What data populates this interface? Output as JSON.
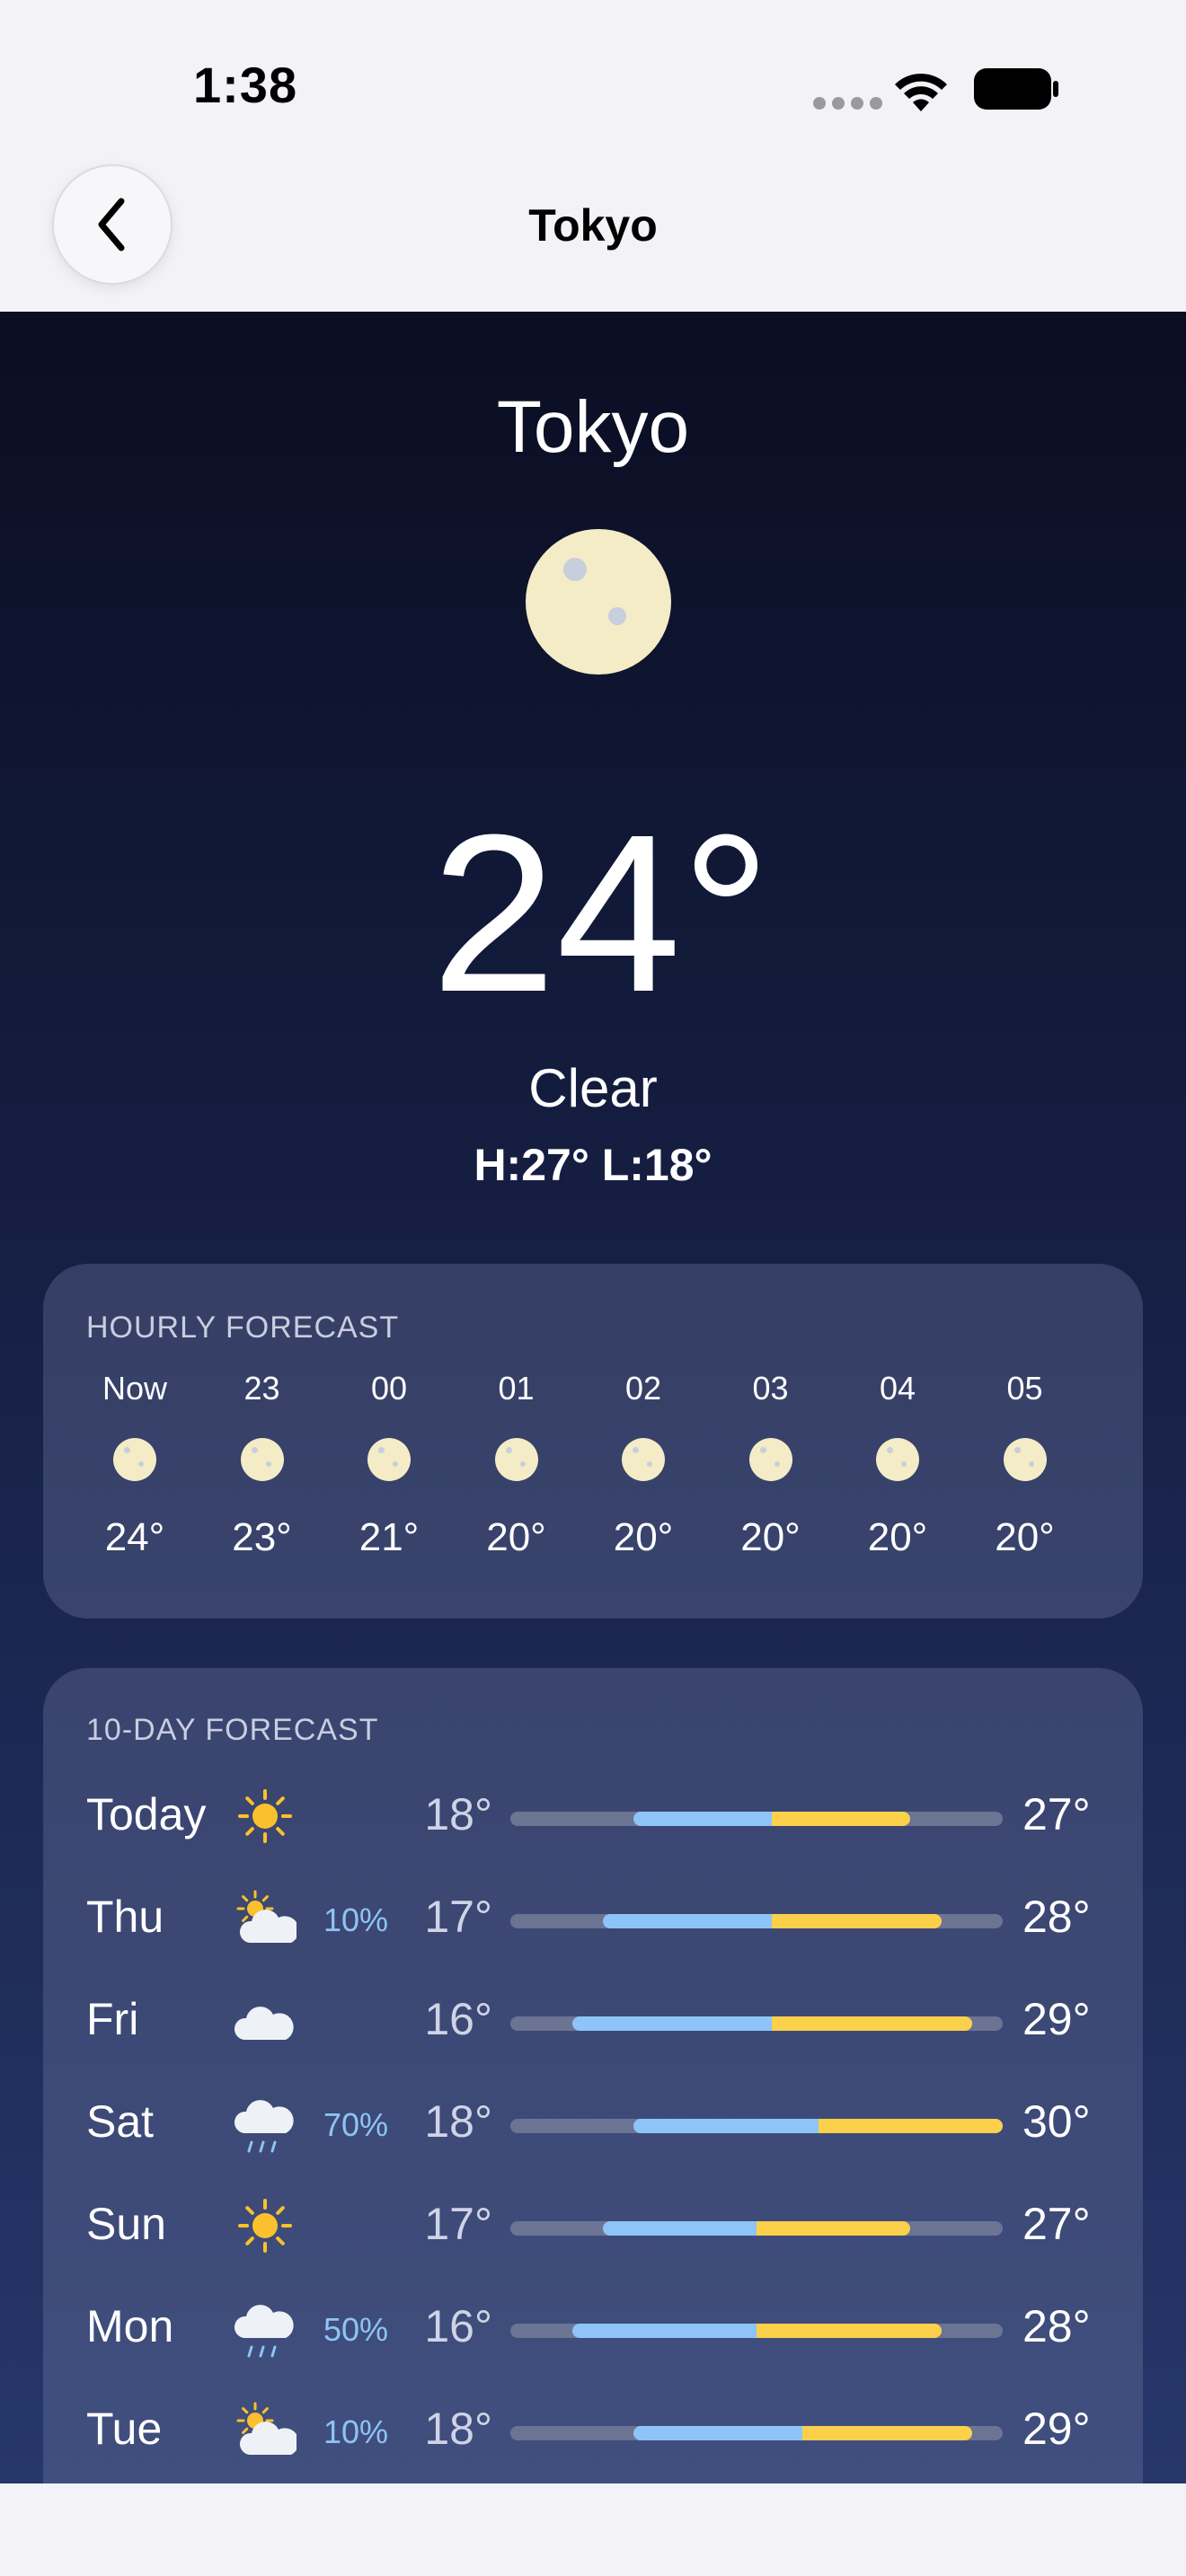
{
  "status": {
    "time": "1:38"
  },
  "nav": {
    "title": "Tokyo"
  },
  "current": {
    "city": "Tokyo",
    "icon": "moon-icon",
    "temperature": "24°",
    "condition": "Clear",
    "high_low": "H:27° L:18°"
  },
  "hourly": {
    "title": "HOURLY FORECAST",
    "items": [
      {
        "label": "Now",
        "icon": "moon-icon",
        "temp": "24°"
      },
      {
        "label": "23",
        "icon": "moon-icon",
        "temp": "23°"
      },
      {
        "label": "00",
        "icon": "moon-icon",
        "temp": "21°"
      },
      {
        "label": "01",
        "icon": "moon-icon",
        "temp": "20°"
      },
      {
        "label": "02",
        "icon": "moon-icon",
        "temp": "20°"
      },
      {
        "label": "03",
        "icon": "moon-icon",
        "temp": "20°"
      },
      {
        "label": "04",
        "icon": "moon-icon",
        "temp": "20°"
      },
      {
        "label": "05",
        "icon": "moon-icon",
        "temp": "20°"
      }
    ]
  },
  "daily": {
    "title": "10-DAY FORECAST",
    "range": {
      "min": 14,
      "max": 30
    },
    "items": [
      {
        "day": "Today",
        "icon": "sun-icon",
        "precip": "",
        "low": "18°",
        "high": "27°",
        "low_val": 18,
        "high_val": 27
      },
      {
        "day": "Thu",
        "icon": "partly-cloudy-icon",
        "precip": "10%",
        "low": "17°",
        "high": "28°",
        "low_val": 17,
        "high_val": 28
      },
      {
        "day": "Fri",
        "icon": "cloud-icon",
        "precip": "",
        "low": "16°",
        "high": "29°",
        "low_val": 16,
        "high_val": 29
      },
      {
        "day": "Sat",
        "icon": "rain-icon",
        "precip": "70%",
        "low": "18°",
        "high": "30°",
        "low_val": 18,
        "high_val": 30
      },
      {
        "day": "Sun",
        "icon": "sun-icon",
        "precip": "",
        "low": "17°",
        "high": "27°",
        "low_val": 17,
        "high_val": 27
      },
      {
        "day": "Mon",
        "icon": "rain-icon",
        "precip": "50%",
        "low": "16°",
        "high": "28°",
        "low_val": 16,
        "high_val": 28
      },
      {
        "day": "Tue",
        "icon": "partly-cloudy-icon",
        "precip": "10%",
        "low": "18°",
        "high": "29°",
        "low_val": 18,
        "high_val": 29
      }
    ]
  },
  "colors": {
    "cold_bar": "#8ec4f8",
    "warm_bar": "#fbd04a",
    "precip_text": "#8ec4f5"
  }
}
